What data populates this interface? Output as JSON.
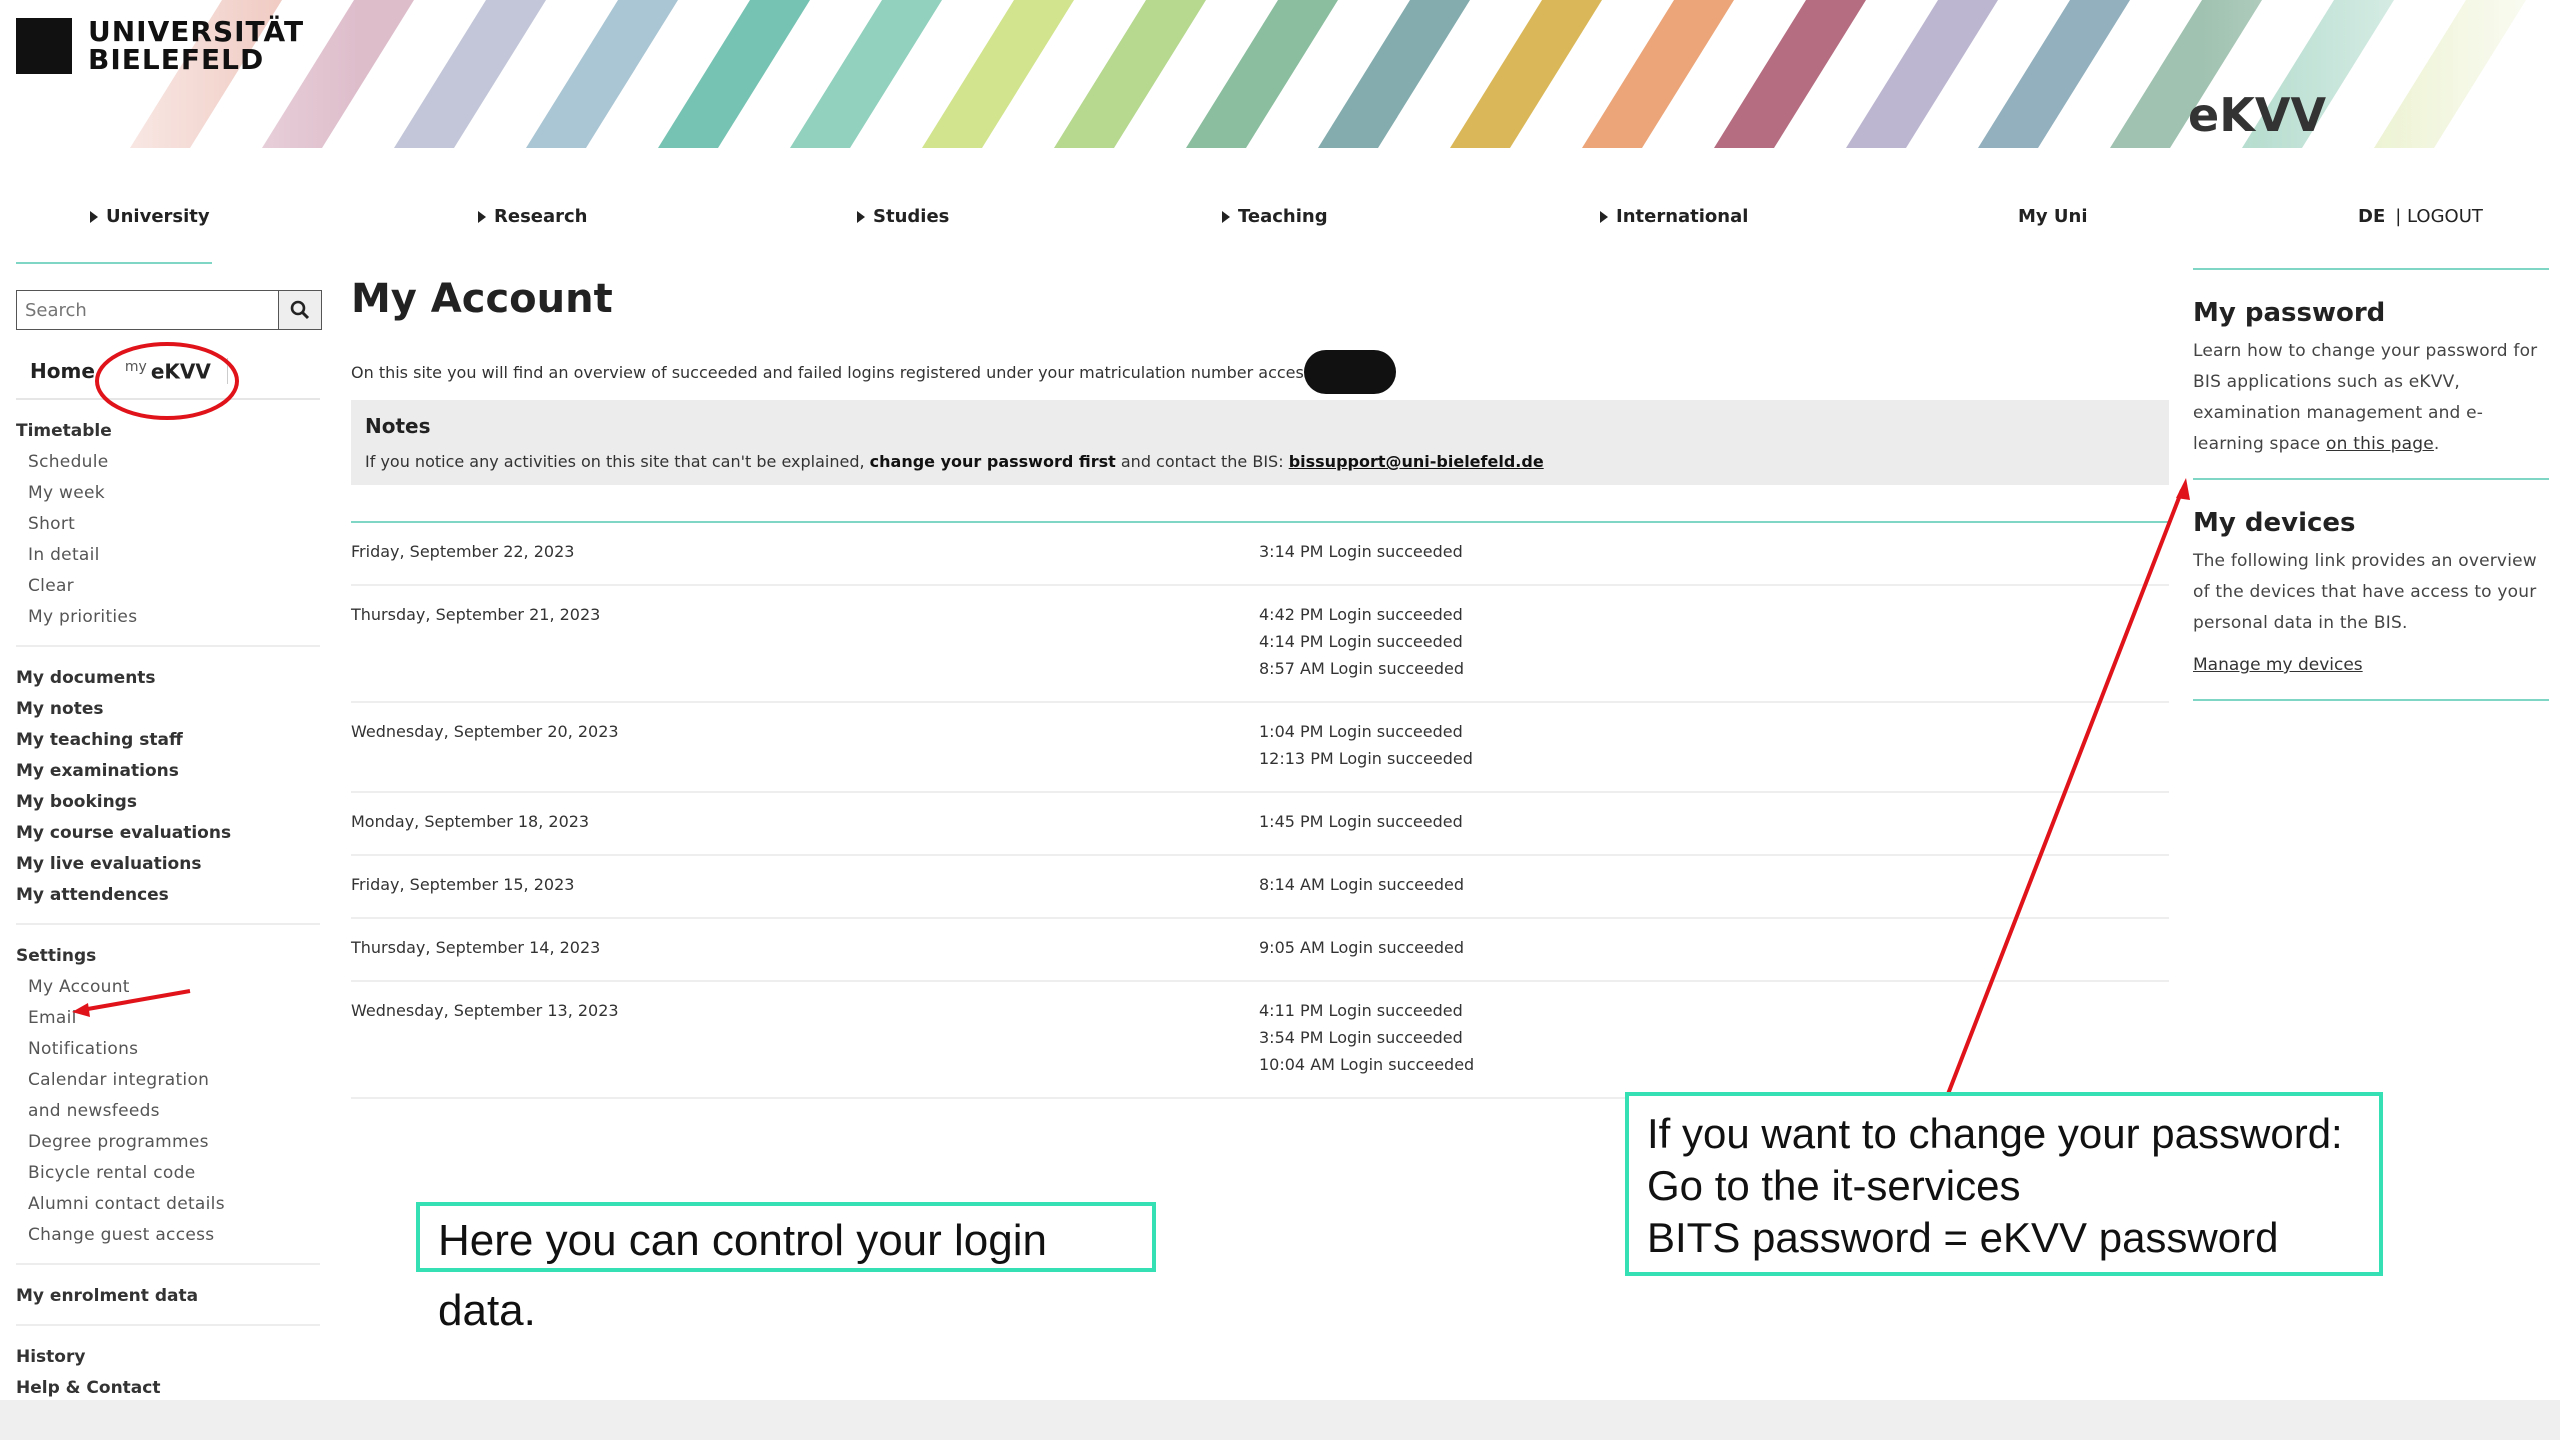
{
  "brand": {
    "university_line1": "UNIVERSITÄT",
    "university_line2": "BIELEFELD",
    "app_title": "eKVV"
  },
  "topnav": {
    "items": [
      "University",
      "Research",
      "Studies",
      "Teaching",
      "International"
    ],
    "my_uni": "My Uni",
    "lang": "DE",
    "logout": "| LOGOUT"
  },
  "sidebar": {
    "search_placeholder": "Search",
    "tab_home": "Home",
    "tab_ekvv_prefix": "my",
    "tab_ekvv": "eKVV",
    "timetable": {
      "head": "Timetable",
      "items": [
        "Schedule",
        "My week",
        "Short",
        "In detail",
        "Clear",
        "My priorities"
      ]
    },
    "personal": [
      "My documents",
      "My notes",
      "My teaching staff",
      "My examinations",
      "My bookings",
      "My course evaluations",
      "My live evaluations",
      "My attendences"
    ],
    "settings": {
      "head": "Settings",
      "items": [
        "My Account",
        "Email",
        "Notifications",
        "Calendar integration",
        "and newsfeeds",
        "Degree programmes",
        "Bicycle rental code",
        "Alumni contact details",
        "Change guest access"
      ]
    },
    "enrolment": "My enrolment data",
    "history": "History",
    "help": "Help & Contact"
  },
  "main": {
    "title": "My Account",
    "intro": "On this site you will find an overview of succeeded and failed logins registered under your matriculation number access",
    "notes_title": "Notes",
    "notes_pre": "If you notice any activities on this site that can't be explained, ",
    "notes_bold": "change your password first",
    "notes_mid": " and contact the BIS: ",
    "notes_email": "bissupport@uni-bielefeld.de",
    "log": [
      {
        "date": "Friday, September 22, 2023",
        "entries": [
          "3:14 PM Login succeeded"
        ]
      },
      {
        "date": "Thursday, September 21, 2023",
        "entries": [
          "4:42 PM Login succeeded",
          "4:14 PM Login succeeded",
          "8:57 AM Login succeeded"
        ]
      },
      {
        "date": "Wednesday, September 20, 2023",
        "entries": [
          "1:04 PM Login succeeded",
          "12:13 PM Login succeeded"
        ]
      },
      {
        "date": "Monday, September 18, 2023",
        "entries": [
          "1:45 PM Login succeeded"
        ]
      },
      {
        "date": "Friday, September 15, 2023",
        "entries": [
          "8:14 AM Login succeeded"
        ]
      },
      {
        "date": "Thursday, September 14, 2023",
        "entries": [
          "9:05 AM Login succeeded"
        ]
      },
      {
        "date": "Wednesday, September 13, 2023",
        "entries": [
          "4:11 PM Login succeeded",
          "3:54 PM Login succeeded",
          "10:04 AM Login succeeded"
        ]
      }
    ]
  },
  "rightbar": {
    "password_title": "My password",
    "password_text": "Learn how to change your password for BIS applications such as eKVV, examination management and e-learning space ",
    "password_link": "on this page",
    "password_end": ".",
    "devices_title": "My devices",
    "devices_text": "The following link provides an overview of the devices that have access to your personal data in the BIS.",
    "devices_link": "Manage my devices"
  },
  "annotations": {
    "callout_login": "Here you can control your login data.",
    "callout_pw_line1": "If you want to change your password:",
    "callout_pw_line2": "Go to the it-services",
    "callout_pw_line3": "BITS password = eKVV password"
  },
  "colors": {
    "accent_teal": "#7fd6c4",
    "callout_border": "#34e0b4",
    "annotation_red": "#e0131b"
  }
}
